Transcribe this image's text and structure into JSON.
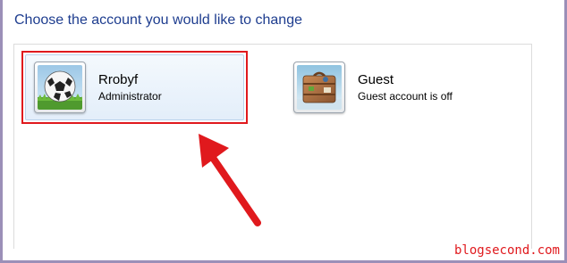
{
  "heading": "Choose the account you would like to change",
  "accounts": [
    {
      "name": "Rrobyf",
      "role": "Administrator",
      "avatar_icon": "soccer-ball-icon",
      "selected": true
    },
    {
      "name": "Guest",
      "role": "Guest account is off",
      "avatar_icon": "suitcase-icon",
      "selected": false
    }
  ],
  "annotation": {
    "highlight_color": "#e0191d",
    "arrow_icon": "red-arrow-icon"
  },
  "watermark": "blogsecond.com",
  "colors": {
    "heading": "#1e3d8f",
    "frame": "#9b8fb8"
  }
}
